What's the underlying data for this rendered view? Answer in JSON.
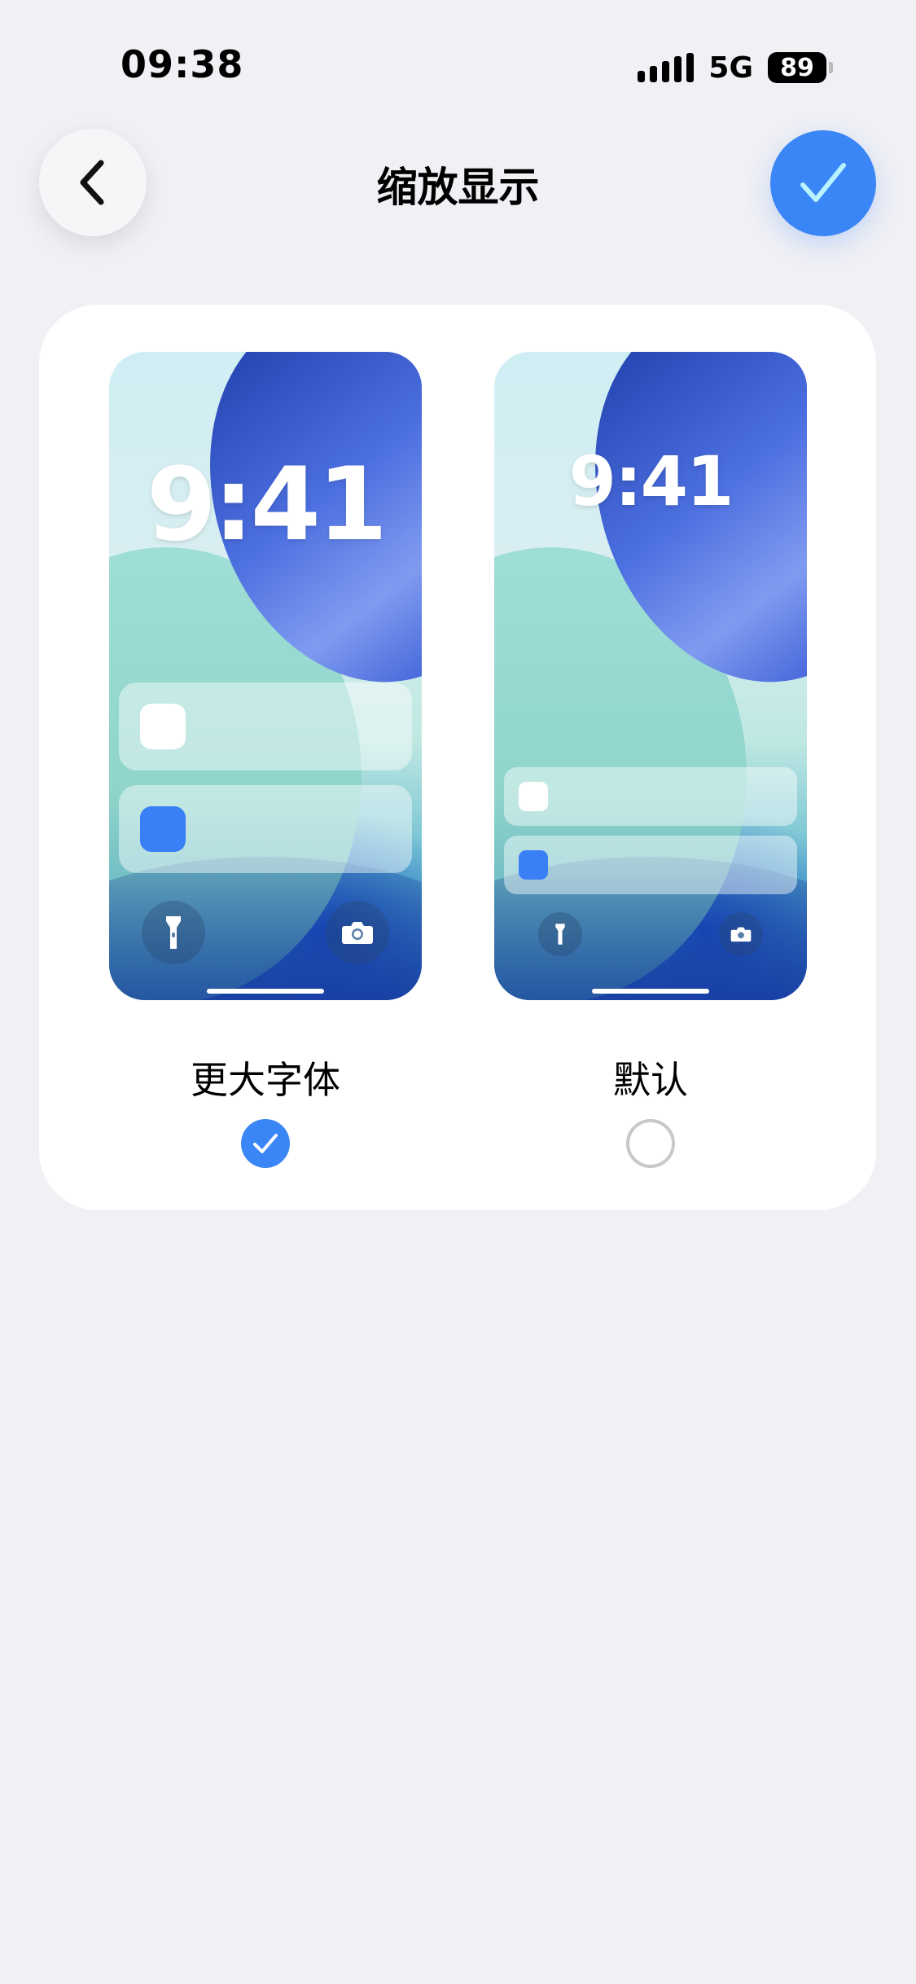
{
  "status_bar": {
    "time": "09:38",
    "network": "5G",
    "battery": "89"
  },
  "nav": {
    "title": "缩放显示",
    "back_icon": "chevron-left-icon",
    "confirm_icon": "checkmark-icon"
  },
  "options": [
    {
      "label": "更大字体",
      "preview_time": "9:41",
      "selected": true
    },
    {
      "label": "默认",
      "preview_time": "9:41",
      "selected": false
    }
  ],
  "colors": {
    "accent": "#3a86f6",
    "background": "#f0f0f5",
    "card": "#ffffff"
  }
}
